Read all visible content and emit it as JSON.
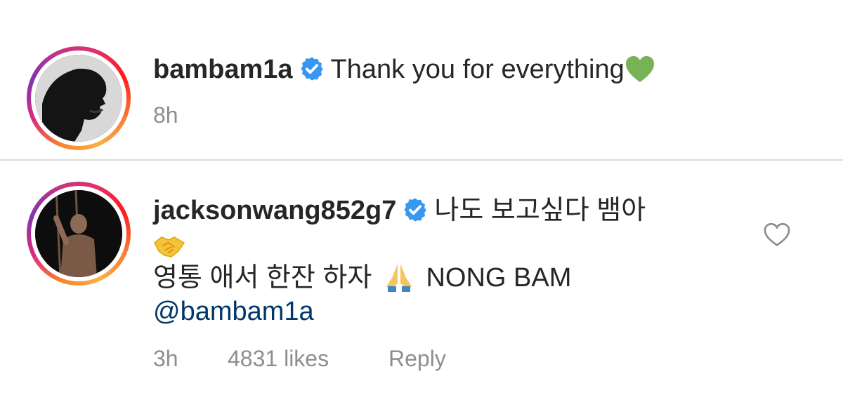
{
  "comments": [
    {
      "username": "bambam1a",
      "verified": true,
      "text": "Thank you for everything",
      "emoji": "green-heart",
      "time": "8h"
    },
    {
      "username": "jacksonwang852g7",
      "verified": true,
      "text_line1": "나도 보고싶다 뱀아",
      "emoji_line2": "handshake",
      "text_line3_a": "영통 애서 한잔 하자",
      "emoji_line3": "folded-hands",
      "text_line3_b": "NONG BAM",
      "mention": "@bambam1a",
      "time": "3h",
      "likes": "4831 likes",
      "reply_label": "Reply"
    }
  ],
  "colors": {
    "verified": "#3897f0",
    "meta_text": "#8e8e8e",
    "mention": "#00376b",
    "divider": "#dbdbdb"
  }
}
